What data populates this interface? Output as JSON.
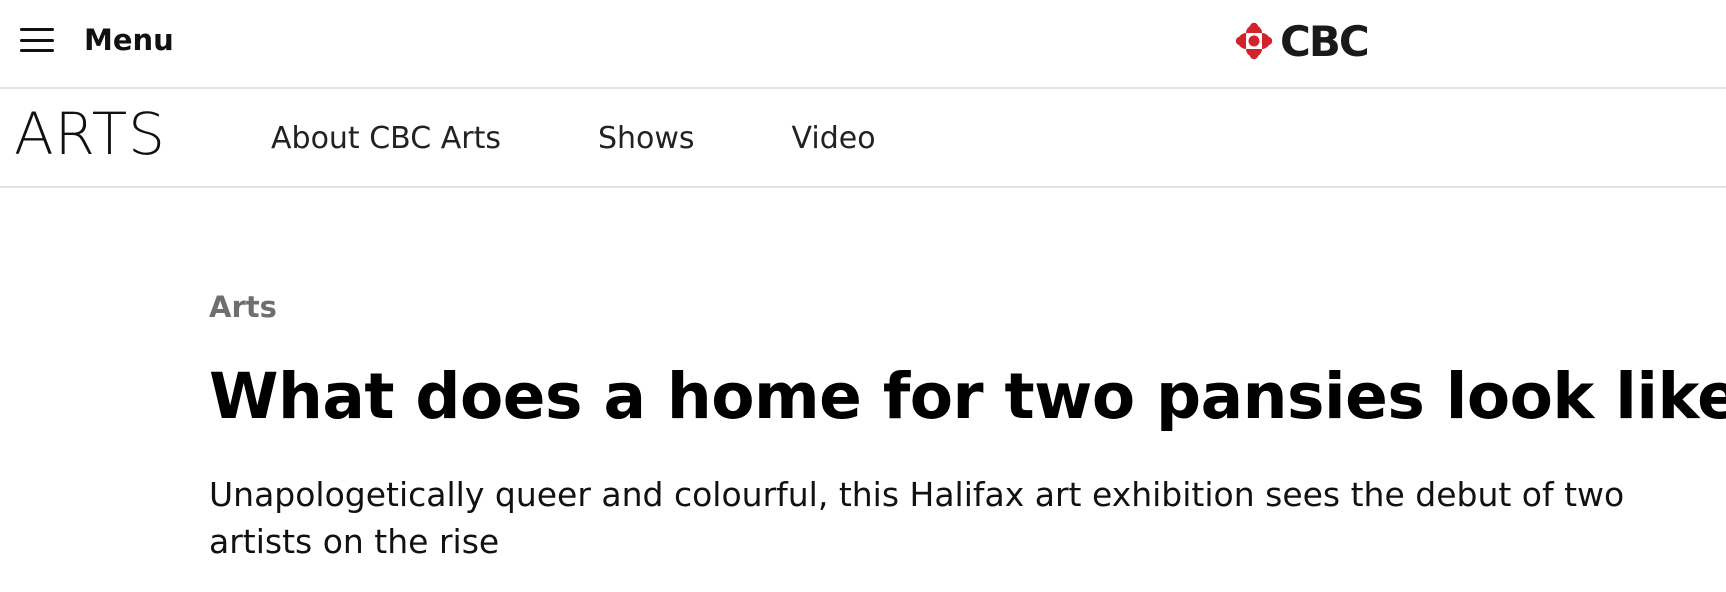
{
  "header": {
    "menu_label": "Menu",
    "brand": "CBC",
    "brand_color": "#d2232a"
  },
  "subnav": {
    "section_logo": "ARTS",
    "links": [
      "About CBC Arts",
      "Shows",
      "Video"
    ]
  },
  "article": {
    "kicker": "Arts",
    "headline": "What does a home for two pansies look like?",
    "deck": "Unapologetically queer and colourful, this Halifax art exhibition sees the debut of two artists on the rise"
  }
}
